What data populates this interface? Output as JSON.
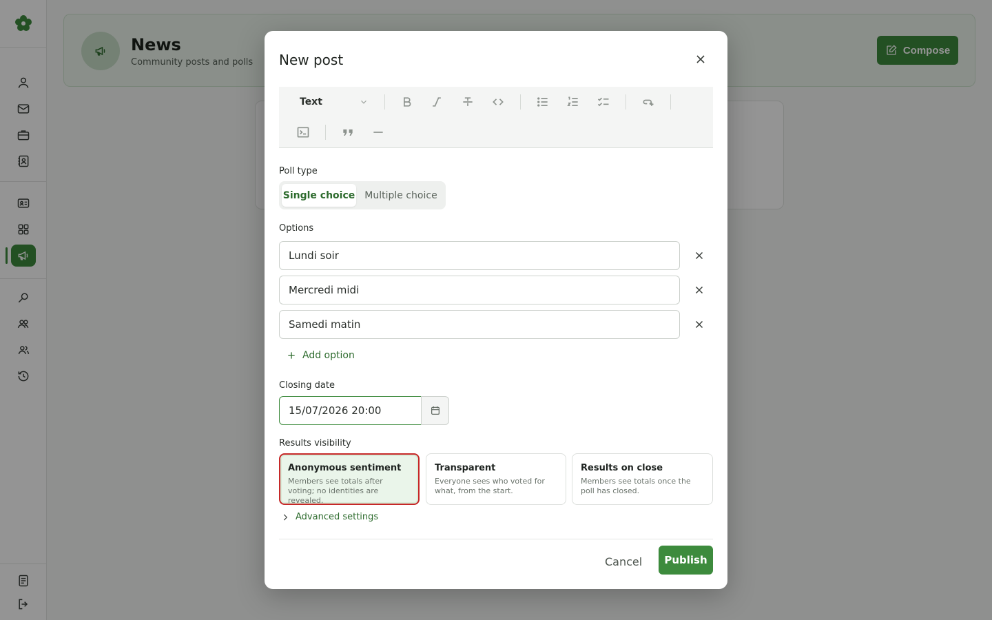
{
  "sidebar": {
    "icons": [
      "user-icon",
      "mail-icon",
      "briefcase-icon",
      "contact-book-icon",
      "id-card-icon",
      "grid-icon",
      "megaphone-icon",
      "search-icon",
      "group-icon",
      "team-icon",
      "history-icon",
      "document-icon",
      "logout-icon"
    ],
    "accent": "#3d8b3d"
  },
  "header": {
    "title": "News",
    "subtitle": "Community posts and polls",
    "compose_label": "Compose"
  },
  "modal": {
    "title": "New post",
    "toolbar": {
      "block_type": "Text",
      "buttons": [
        "bold",
        "italic",
        "strikethrough",
        "code",
        "bullet-list",
        "numbered-list",
        "checklist",
        "link",
        "code-block",
        "quote",
        "horizontal-rule"
      ]
    },
    "poll_type": {
      "label": "Poll type",
      "options": [
        "Single choice",
        "Multiple choice"
      ],
      "selected": "Single choice"
    },
    "options": {
      "label": "Options",
      "values": [
        "Lundi soir",
        "Mercredi midi",
        "Samedi matin"
      ],
      "add_label": "Add option"
    },
    "closing_date": {
      "label": "Closing date",
      "value": "15/07/2026 20:00"
    },
    "results_visibility": {
      "label": "Results visibility",
      "cards": [
        {
          "title": "Anonymous sentiment",
          "desc": "Members see totals after voting; no identities are revealed."
        },
        {
          "title": "Transparent",
          "desc": "Everyone sees who voted for what, from the start."
        },
        {
          "title": "Results on close",
          "desc": "Members see totals once the poll has closed."
        }
      ],
      "selected": "Anonymous sentiment"
    },
    "advanced_label": "Advanced settings",
    "cancel_label": "Cancel",
    "publish_label": "Publish"
  }
}
